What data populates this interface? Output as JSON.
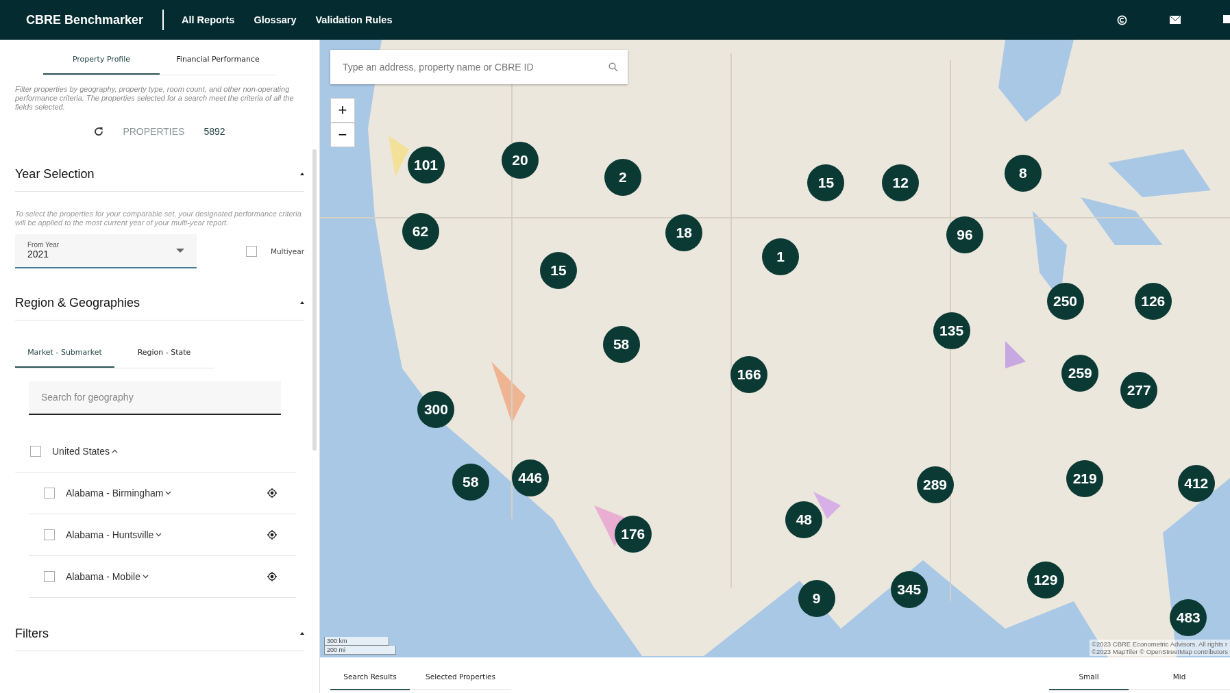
{
  "header": {
    "brand": "CBRE Benchmarker",
    "nav": [
      {
        "label": "All Reports"
      },
      {
        "label": "Glossary"
      },
      {
        "label": "Validation Rules"
      }
    ]
  },
  "sidebar": {
    "tabs": [
      {
        "label": "Property Profile",
        "selected": true
      },
      {
        "label": "Financial Performance",
        "selected": false
      }
    ],
    "intro": "Filter properties by geography, property type, room count, and other non-operating performance criteria. The properties selected for a search meet the criteria of all the fields selected.",
    "properties_label": "PROPERTIES",
    "properties_count": "5892",
    "sections": [
      {
        "kind": "year",
        "title": "Year Selection",
        "expanded": true,
        "note": "To select the properties for your comparable set, your designated performance criteria will be applied to the most current year of your multi-year report.",
        "from_year": {
          "label": "From Year",
          "value": "2021"
        },
        "multiyear": {
          "label": "Multiyear",
          "checked": false
        }
      },
      {
        "kind": "region",
        "title": "Region & Geographies",
        "expanded": true,
        "tabs": [
          {
            "label": "Market - Submarket",
            "selected": true
          },
          {
            "label": "Region - State",
            "selected": false
          }
        ],
        "search": {
          "placeholder": "Search for geography"
        },
        "tree": [
          {
            "label": "United States",
            "checked": false,
            "expanded": true,
            "children": [
              {
                "label": "Alabama - Birmingham",
                "checked": false,
                "expanded": false
              },
              {
                "label": "Alabama - Huntsville",
                "checked": false,
                "expanded": false
              },
              {
                "label": "Alabama - Mobile",
                "checked": false,
                "expanded": false
              }
            ]
          }
        ]
      },
      {
        "kind": "filters",
        "title": "Filters",
        "expanded": true
      }
    ]
  },
  "map": {
    "search": {
      "placeholder": "Type an address, property name or CBRE ID"
    },
    "zoom": [
      "+",
      "−"
    ],
    "clusters": [
      "101",
      "20",
      "2",
      "15",
      "12",
      "8",
      "62",
      "18",
      "1",
      "96",
      "15",
      "250",
      "126",
      "58",
      "135",
      "166",
      "259",
      "277",
      "300",
      "58",
      "446",
      "289",
      "219",
      "412",
      "48",
      "176",
      "129",
      "345",
      "9",
      "483"
    ],
    "scale": [
      "300 km",
      "200 mi"
    ],
    "attribution": [
      "©2023 CBRE Econometric Advisors. All rights r",
      "©2023 MapTiler © OpenStreetMap contributors"
    ]
  },
  "results": {
    "tabs": [
      {
        "label": "Search Results",
        "selected": true
      },
      {
        "label": "Selected Properties",
        "selected": false
      }
    ],
    "sizes": [
      {
        "label": "Small",
        "selected": true
      },
      {
        "label": "Mid",
        "selected": false
      }
    ]
  }
}
